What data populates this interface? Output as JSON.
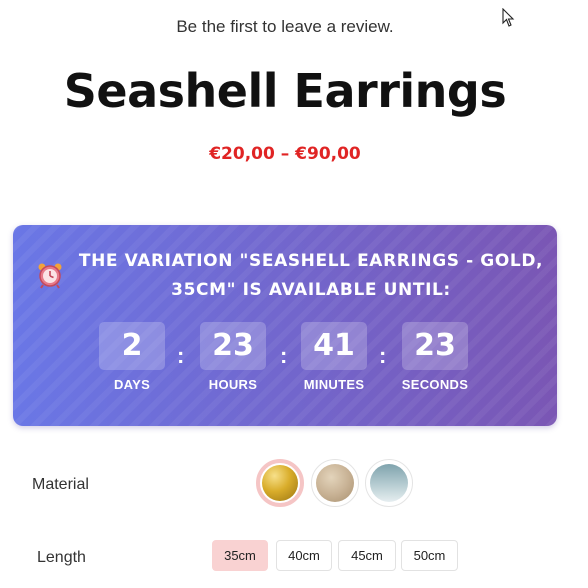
{
  "review": {
    "text": "Be the first to leave a review."
  },
  "product": {
    "title": "Seashell Earrings",
    "price_range": "€20,00 – €90,00"
  },
  "countdown": {
    "icon": "alarm-clock-icon",
    "heading_line1": "The variation \"Seashell Earrings - Gold,",
    "heading_line2": "35cm\" is available until:",
    "units": [
      {
        "value": "2",
        "label": "DAYS"
      },
      {
        "value": "23",
        "label": "HOURS"
      },
      {
        "value": "41",
        "label": "MINUTES"
      },
      {
        "value": "23",
        "label": "SECONDS"
      }
    ],
    "separator": ":",
    "colors": {
      "gradient_start": "#6a77e6",
      "gradient_end": "#7a56b4"
    }
  },
  "material": {
    "label": "Material",
    "options": [
      {
        "name": "gold",
        "selected": true
      },
      {
        "name": "champagne",
        "selected": false
      },
      {
        "name": "silver-blue",
        "selected": false
      }
    ]
  },
  "length": {
    "label": "Length",
    "options": [
      {
        "label": "35cm",
        "selected": true
      },
      {
        "label": "40cm",
        "selected": false
      },
      {
        "label": "45cm",
        "selected": false
      },
      {
        "label": "50cm",
        "selected": false
      }
    ]
  },
  "colors": {
    "price": "#e02424",
    "selected_option": "#f9d2d2"
  }
}
